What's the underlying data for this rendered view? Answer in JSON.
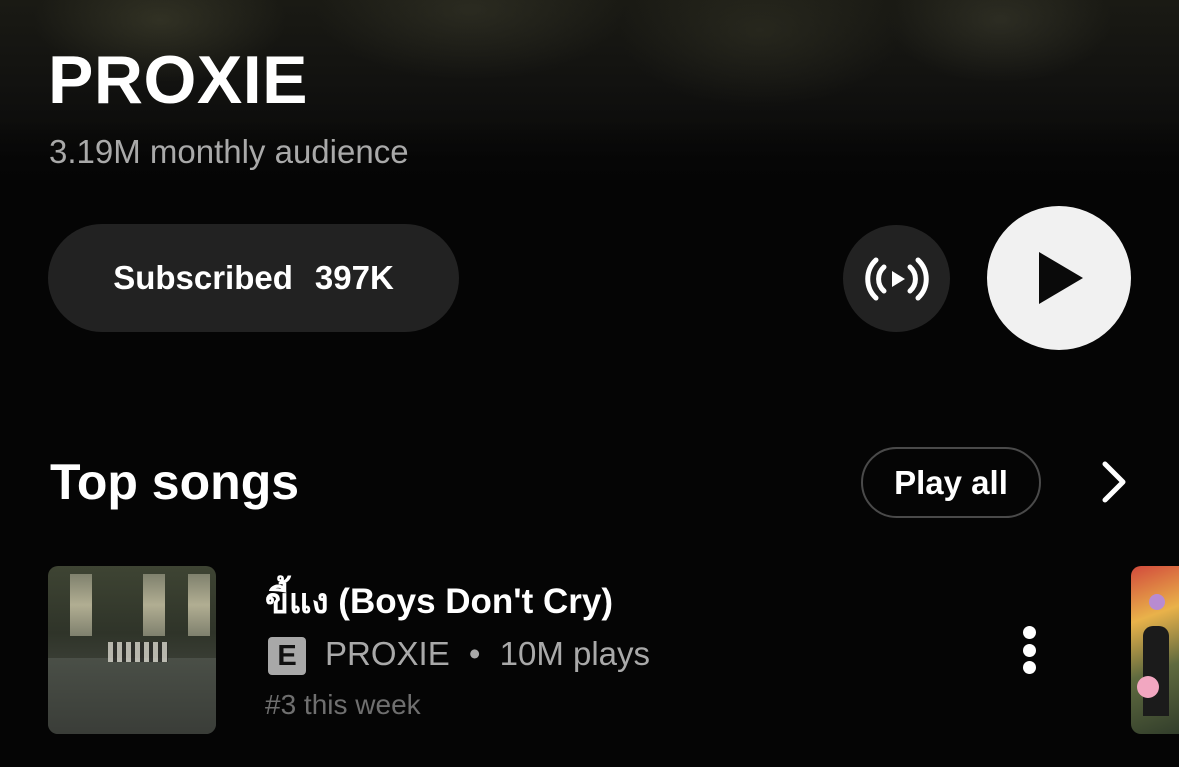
{
  "artist": {
    "name": "PROXIE",
    "audience": "3.19M monthly audience"
  },
  "actions": {
    "subscribe_label": "Subscribed",
    "subscribe_count": "397K",
    "radio_icon": "radio-broadcast-icon",
    "play_icon": "play-icon"
  },
  "top_songs": {
    "title": "Top songs",
    "play_all_label": "Play all",
    "songs": [
      {
        "title": "ขี้แง (Boys Don't Cry)",
        "explicit_badge": "E",
        "artist": "PROXIE",
        "separator": "•",
        "plays": "10M plays",
        "rank": "#3 this week"
      }
    ]
  },
  "colors": {
    "background": "#050505",
    "button_dark": "#222222",
    "play_button": "#f1f1f1",
    "secondary_text": "#a9a9a9",
    "tertiary_text": "#6f6f6f"
  }
}
